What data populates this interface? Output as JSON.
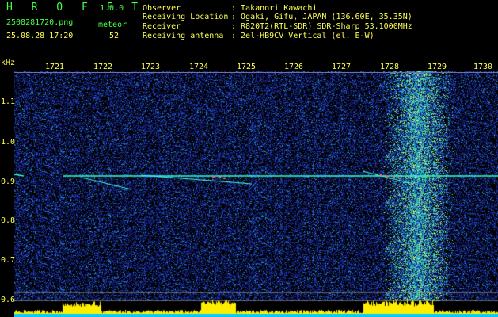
{
  "header": {
    "app_title": "H R O F F T",
    "version": "1.0.0",
    "filename": "2508281720.png",
    "mode": "meteor",
    "datetime": "25.08.28 17:20",
    "count": "52"
  },
  "info": [
    {
      "label": "Observer",
      "value": ": Takanori Kawachi"
    },
    {
      "label": "Receiving Location",
      "value": ": Ogaki, Gifu, JAPAN (136.60E, 35.35N)"
    },
    {
      "label": "Receiver",
      "value": ": R820T2(RTL-SDR) SDR-Sharp 53.1000MHz"
    },
    {
      "label": "Receiving antenna",
      "value": ": 2el-HB9CV Vertical (el. E-W)"
    }
  ],
  "axes": {
    "y_unit": "kHz",
    "x_ticks": [
      "1721",
      "1722",
      "1723",
      "1724",
      "1725",
      "1726",
      "1727",
      "1728",
      "1729",
      "1730"
    ],
    "y_ticks": [
      "1.1",
      "1.0",
      "0.9",
      "0.8",
      "0.7",
      "0.6"
    ]
  },
  "colors": {
    "background": "#000000",
    "noise": "#1a2a9a",
    "signal": "#33ffcc",
    "meteor_hot": "#ff5555",
    "histogram": "#ffee00",
    "baseline": "#00ccff",
    "labels_green": "#44ff44",
    "labels_yellow": "#ffff55"
  }
}
